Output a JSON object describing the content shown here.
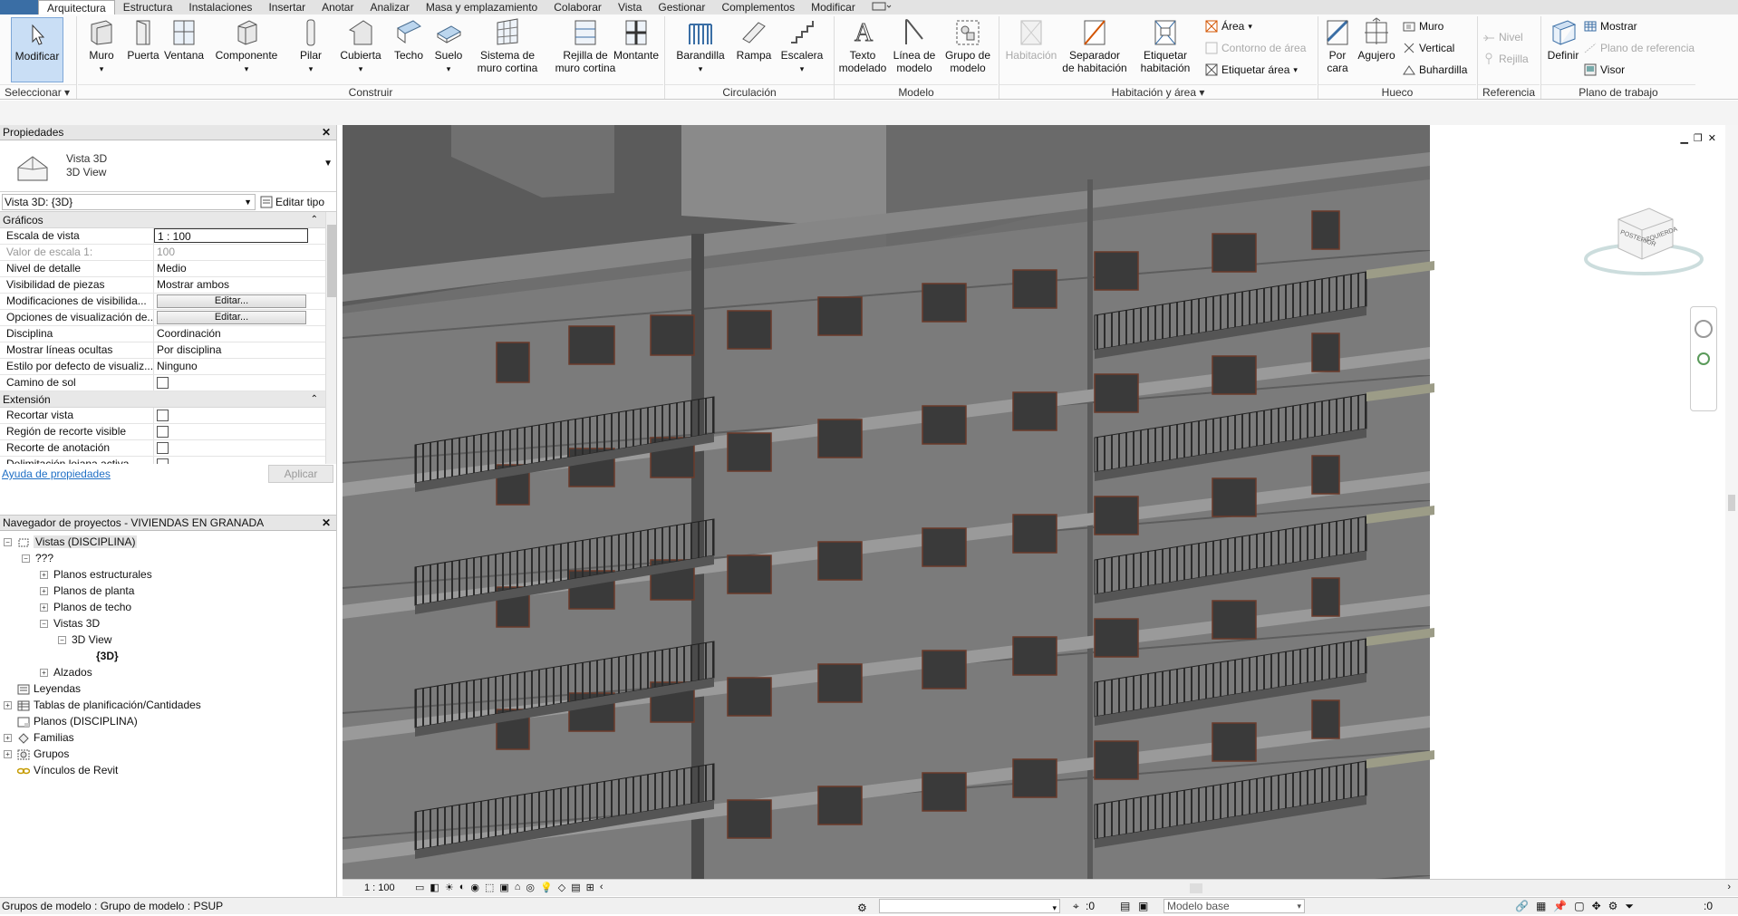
{
  "ribbon_tabs": [
    {
      "label": "Arquitectura",
      "active": true
    },
    {
      "label": "Estructura"
    },
    {
      "label": "Instalaciones"
    },
    {
      "label": "Insertar"
    },
    {
      "label": "Anotar"
    },
    {
      "label": "Analizar"
    },
    {
      "label": "Masa y emplazamiento"
    },
    {
      "label": "Colaborar"
    },
    {
      "label": "Vista"
    },
    {
      "label": "Gestionar"
    },
    {
      "label": "Complementos"
    },
    {
      "label": "Modificar"
    }
  ],
  "tools": {
    "modificar": "Modificar",
    "muro": "Muro",
    "puerta": "Puerta",
    "ventana": "Ventana",
    "componente": "Componente",
    "pilar": "Pilar",
    "cubierta": "Cubierta",
    "techo": "Techo",
    "suelo": "Suelo",
    "sistema_muro_cortina_1": "Sistema de",
    "sistema_muro_cortina_2": "muro cortina",
    "rejilla_1": "Rejilla de",
    "rejilla_2": "muro cortina",
    "montante": "Montante",
    "barandilla": "Barandilla",
    "rampa": "Rampa",
    "escalera": "Escalera",
    "texto_1": "Texto",
    "texto_2": "modelado",
    "linea_1": "Línea de",
    "linea_2": "modelo",
    "grupo_1": "Grupo de",
    "grupo_2": "modelo",
    "habitacion": "Habitación",
    "separador_1": "Separador",
    "separador_2": "de habitación",
    "etiquetar_1": "Etiquetar",
    "etiquetar_2": "habitación",
    "area": "Área",
    "contorno_area": "Contorno de área",
    "etiquetar_area": "Etiquetar área",
    "por_cara_1": "Por",
    "por_cara_2": "cara",
    "agujero": "Agujero",
    "muro_hueco": "Muro",
    "vertical": "Vertical",
    "buhardilla": "Buhardilla",
    "nivel": "Nivel",
    "rejilla": "Rejilla",
    "definir": "Definir",
    "mostrar": "Mostrar",
    "plano_referencia": "Plano de referencia",
    "visor": "Visor"
  },
  "ribbon_groups": {
    "seleccionar": "Seleccionar",
    "construir": "Construir",
    "circulacion": "Circulación",
    "modelo": "Modelo",
    "habitacion_area": "Habitación y área",
    "hueco": "Hueco",
    "referencia": "Referencia",
    "plano_trabajo": "Plano de trabajo"
  },
  "properties": {
    "title": "Propiedades",
    "type_name": "Vista 3D",
    "type_sub": "3D View",
    "instance_selector": "Vista 3D: {3D}",
    "edit_type": "Editar tipo",
    "section_graficos": "Gráficos",
    "section_extension": "Extensión",
    "rows_graficos": [
      {
        "k": "Escala de vista",
        "v": "1 : 100"
      },
      {
        "k": "Valor de escala    1:",
        "v": "100"
      },
      {
        "k": "Nivel de detalle",
        "v": "Medio"
      },
      {
        "k": "Visibilidad de piezas",
        "v": "Mostrar ambos"
      },
      {
        "k": "Modificaciones de visibilida...",
        "v": "Editar..."
      },
      {
        "k": "Opciones de visualización de...",
        "v": "Editar..."
      },
      {
        "k": "Disciplina",
        "v": "Coordinación"
      },
      {
        "k": "Mostrar líneas ocultas",
        "v": "Por disciplina"
      },
      {
        "k": "Estilo por defecto de visualiz...",
        "v": "Ninguno"
      },
      {
        "k": "Camino de sol",
        "v": ""
      }
    ],
    "rows_extension": [
      {
        "k": "Recortar vista"
      },
      {
        "k": "Región de recorte visible"
      },
      {
        "k": "Recorte de anotación"
      },
      {
        "k": "Delimitación lejana activa"
      }
    ],
    "help_link": "Ayuda de propiedades",
    "apply": "Aplicar"
  },
  "browser": {
    "title": "Navegador de proyectos - VIVIENDAS EN GRANADA",
    "items": [
      {
        "label": "Vistas (DISCIPLINA)"
      },
      {
        "label": "???"
      },
      {
        "label": "Planos estructurales"
      },
      {
        "label": "Planos de planta"
      },
      {
        "label": "Planos de techo"
      },
      {
        "label": "Vistas 3D"
      },
      {
        "label": "3D View"
      },
      {
        "label": "{3D}"
      },
      {
        "label": "Alzados"
      },
      {
        "label": "Leyendas"
      },
      {
        "label": "Tablas de planificación/Cantidades"
      },
      {
        "label": "Planos (DISCIPLINA)"
      },
      {
        "label": "Familias"
      },
      {
        "label": "Grupos"
      },
      {
        "label": "Vínculos de Revit"
      }
    ]
  },
  "viewcube_label": "POSTERIOR",
  "viewcube_label2": "IZQUIERDA",
  "view_scale": "1 : 100",
  "status": {
    "text": "Grupos de modelo : Grupo de modelo : PSUP",
    "coord": ":0",
    "model": "Modelo base",
    "filter": ":0"
  },
  "colors": {
    "accent": "#3a6ea5",
    "wall": "#7c7c7c",
    "window": "#3d3d3d"
  }
}
